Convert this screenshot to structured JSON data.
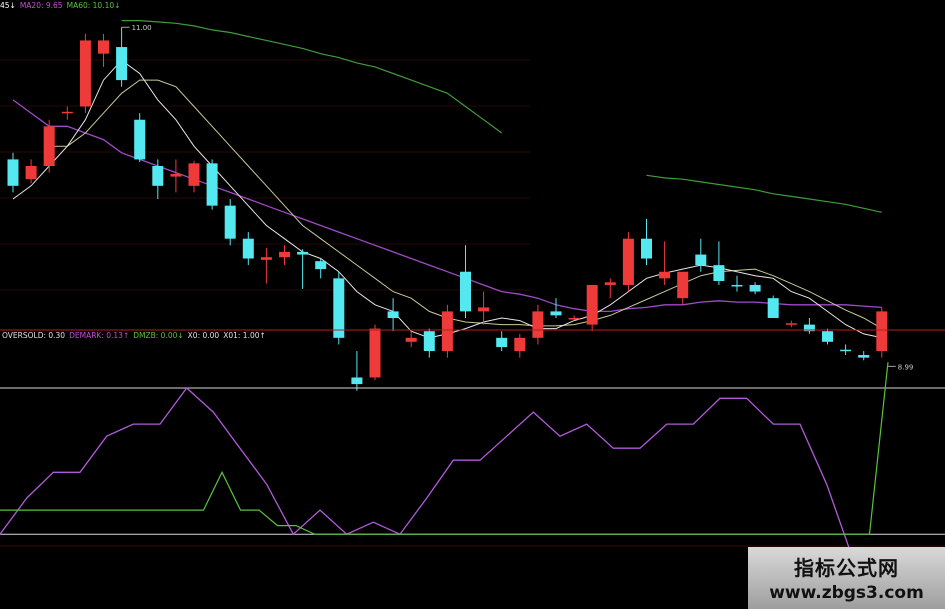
{
  "legend_top": [
    {
      "text": "45↓",
      "color": "#ffffff"
    },
    {
      "text": "MA20: 9.65",
      "color": "#c84fd8"
    },
    {
      "text": "MA60: 10.10↓",
      "color": "#59c33c"
    }
  ],
  "legend_bottom": [
    {
      "text": "OVERSOLD: 0.30",
      "color": "#e0e0e0"
    },
    {
      "text": "DEMARK: 0.13↑",
      "color": "#c84fd8"
    },
    {
      "text": "DMZB: 0.00↓",
      "color": "#59c33c"
    },
    {
      "text": "X0: 0.00",
      "color": "#e0e0e0"
    },
    {
      "text": "X01: 1.00↑",
      "color": "#e0e0e0"
    }
  ],
  "annotations": {
    "high_label": "11.00",
    "low_label": "8.99"
  },
  "watermark": {
    "line1": "指标公式网",
    "line2": "www.zbgs3.com"
  },
  "colors": {
    "up": "#ef3a3a",
    "down": "#54e8f0",
    "ma20": "#a04ac8",
    "ma60": "#3f9c3a",
    "ma_short1": "#e6e6e6",
    "ma_short2": "#c9c99a",
    "demark": "#b05ad8",
    "dmzb": "#59c33c",
    "guide": "#d8d8d8",
    "divider": "#b02020"
  },
  "chart_data": [
    {
      "type": "candlestick",
      "ylim": [
        8.8,
        11.1
      ],
      "candles": [
        {
          "o": 10.0,
          "h": 10.05,
          "l": 9.75,
          "c": 9.8
        },
        {
          "o": 9.85,
          "h": 10.0,
          "l": 9.82,
          "c": 9.95
        },
        {
          "o": 9.95,
          "h": 10.3,
          "l": 9.9,
          "c": 10.25
        },
        {
          "o": 10.35,
          "h": 10.4,
          "l": 10.3,
          "c": 10.36
        },
        {
          "o": 10.4,
          "h": 10.95,
          "l": 10.35,
          "c": 10.9
        },
        {
          "o": 10.8,
          "h": 10.95,
          "l": 10.7,
          "c": 10.9
        },
        {
          "o": 10.85,
          "h": 11.0,
          "l": 10.55,
          "c": 10.6
        },
        {
          "o": 10.3,
          "h": 10.35,
          "l": 9.98,
          "c": 10.0
        },
        {
          "o": 9.95,
          "h": 10.0,
          "l": 9.7,
          "c": 9.8
        },
        {
          "o": 9.87,
          "h": 10.0,
          "l": 9.75,
          "c": 9.89
        },
        {
          "o": 9.8,
          "h": 9.99,
          "l": 9.75,
          "c": 9.97
        },
        {
          "o": 9.97,
          "h": 10.0,
          "l": 9.62,
          "c": 9.65
        },
        {
          "o": 9.65,
          "h": 9.7,
          "l": 9.35,
          "c": 9.4
        },
        {
          "o": 9.4,
          "h": 9.45,
          "l": 9.2,
          "c": 9.25
        },
        {
          "o": 9.24,
          "h": 9.33,
          "l": 9.06,
          "c": 9.26
        },
        {
          "o": 9.26,
          "h": 9.35,
          "l": 9.2,
          "c": 9.3
        },
        {
          "o": 9.3,
          "h": 9.32,
          "l": 9.02,
          "c": 9.28
        },
        {
          "o": 9.23,
          "h": 9.25,
          "l": 9.1,
          "c": 9.17
        },
        {
          "o": 9.1,
          "h": 9.15,
          "l": 8.6,
          "c": 8.65
        },
        {
          "o": 8.35,
          "h": 8.55,
          "l": 8.25,
          "c": 8.3
        },
        {
          "o": 8.35,
          "h": 8.75,
          "l": 8.33,
          "c": 8.72
        },
        {
          "o": 8.85,
          "h": 8.95,
          "l": 8.7,
          "c": 8.8
        },
        {
          "o": 8.62,
          "h": 8.7,
          "l": 8.58,
          "c": 8.65
        },
        {
          "o": 8.7,
          "h": 8.72,
          "l": 8.5,
          "c": 8.55
        },
        {
          "o": 8.55,
          "h": 8.9,
          "l": 8.5,
          "c": 8.85
        },
        {
          "o": 9.15,
          "h": 9.35,
          "l": 8.8,
          "c": 8.85
        },
        {
          "o": 8.85,
          "h": 9.0,
          "l": 8.75,
          "c": 8.88
        },
        {
          "o": 8.65,
          "h": 8.7,
          "l": 8.55,
          "c": 8.58
        },
        {
          "o": 8.55,
          "h": 8.68,
          "l": 8.5,
          "c": 8.65
        },
        {
          "o": 8.65,
          "h": 8.9,
          "l": 8.6,
          "c": 8.85
        },
        {
          "o": 8.85,
          "h": 8.95,
          "l": 8.8,
          "c": 8.82
        },
        {
          "o": 8.8,
          "h": 8.82,
          "l": 8.78,
          "c": 8.8
        },
        {
          "o": 8.75,
          "h": 9.05,
          "l": 8.7,
          "c": 9.05
        },
        {
          "o": 9.05,
          "h": 9.1,
          "l": 8.95,
          "c": 9.07
        },
        {
          "o": 9.05,
          "h": 9.45,
          "l": 9.0,
          "c": 9.4
        },
        {
          "o": 9.4,
          "h": 9.55,
          "l": 9.2,
          "c": 9.25
        },
        {
          "o": 9.1,
          "h": 9.38,
          "l": 9.05,
          "c": 9.15
        },
        {
          "o": 8.95,
          "h": 9.1,
          "l": 8.9,
          "c": 9.15
        },
        {
          "o": 9.28,
          "h": 9.4,
          "l": 9.15,
          "c": 9.2
        },
        {
          "o": 9.2,
          "h": 9.38,
          "l": 9.05,
          "c": 9.08
        },
        {
          "o": 9.05,
          "h": 9.12,
          "l": 9.0,
          "c": 9.04
        },
        {
          "o": 9.05,
          "h": 9.07,
          "l": 8.98,
          "c": 9.0
        },
        {
          "o": 8.95,
          "h": 8.97,
          "l": 8.8,
          "c": 8.8
        },
        {
          "o": 8.75,
          "h": 8.78,
          "l": 8.73,
          "c": 8.76
        },
        {
          "o": 8.75,
          "h": 8.8,
          "l": 8.68,
          "c": 8.7
        },
        {
          "o": 8.7,
          "h": 8.72,
          "l": 8.6,
          "c": 8.62
        },
        {
          "o": 8.56,
          "h": 8.6,
          "l": 8.52,
          "c": 8.55
        },
        {
          "o": 8.52,
          "h": 8.55,
          "l": 8.48,
          "c": 8.5
        },
        {
          "o": 8.55,
          "h": 8.88,
          "l": 8.5,
          "c": 8.85
        }
      ],
      "ma20": [
        10.45,
        10.35,
        10.25,
        10.25,
        10.2,
        10.15,
        10.05,
        10.0,
        9.95,
        9.9,
        9.85,
        9.8,
        9.75,
        9.7,
        9.65,
        9.6,
        9.55,
        9.5,
        9.45,
        9.4,
        9.35,
        9.3,
        9.25,
        9.2,
        9.15,
        9.1,
        9.05,
        9.0,
        8.98,
        8.95,
        8.9,
        8.87,
        8.85,
        8.85,
        8.87,
        8.88,
        8.9,
        8.9,
        8.92,
        8.93,
        8.92,
        8.92,
        8.91,
        8.9,
        8.9,
        8.9,
        8.9,
        8.89,
        8.88
      ],
      "ma60": [
        null,
        null,
        null,
        null,
        null,
        null,
        11.05,
        11.05,
        11.04,
        11.03,
        11.01,
        10.98,
        10.96,
        10.93,
        10.9,
        10.87,
        10.84,
        10.8,
        10.77,
        10.73,
        10.7,
        10.65,
        10.6,
        10.55,
        10.5,
        10.4,
        10.3,
        10.2,
        null,
        null,
        null,
        null,
        null,
        null,
        null,
        9.88,
        9.86,
        9.85,
        9.83,
        9.81,
        9.79,
        9.77,
        9.74,
        9.72,
        9.7,
        9.68,
        9.66,
        9.63,
        9.6
      ],
      "ma5": [
        9.7,
        9.8,
        9.95,
        10.1,
        10.3,
        10.6,
        10.75,
        10.65,
        10.45,
        10.3,
        10.1,
        9.95,
        9.8,
        9.65,
        9.5,
        9.4,
        9.3,
        9.25,
        9.15,
        9.0,
        8.9,
        8.85,
        8.7,
        8.65,
        8.68,
        8.72,
        8.77,
        8.8,
        8.78,
        8.72,
        8.72,
        8.78,
        8.82,
        8.9,
        9.0,
        9.1,
        9.14,
        9.17,
        9.2,
        9.18,
        9.15,
        9.12,
        9.1,
        9.0,
        8.95,
        8.85,
        8.75,
        8.68,
        8.65
      ],
      "ma10": [
        null,
        null,
        10.1,
        10.1,
        10.2,
        10.35,
        10.5,
        10.6,
        10.6,
        10.55,
        10.4,
        10.25,
        10.1,
        9.95,
        9.8,
        9.65,
        9.5,
        9.4,
        9.3,
        9.2,
        9.1,
        9.0,
        8.95,
        8.85,
        8.8,
        8.77,
        8.76,
        8.75,
        8.75,
        8.74,
        8.74,
        8.75,
        8.78,
        8.82,
        8.88,
        8.94,
        9.0,
        9.06,
        9.12,
        9.15,
        9.16,
        9.17,
        9.12,
        9.06,
        9.0,
        8.93,
        8.86,
        8.8,
        8.72
      ]
    },
    {
      "type": "line",
      "ylim": [
        -0.15,
        1.1
      ],
      "guides": {
        "oversold": 0.3,
        "x0": 0.0,
        "x01": 1.0
      },
      "series": [
        {
          "name": "DEMARK",
          "values": [
            0.0,
            0.21,
            0.36,
            0.36,
            0.57,
            0.64,
            0.64,
            0.85,
            0.71,
            0.5,
            0.29,
            0.0,
            0.14,
            0.0,
            0.07,
            0.0,
            0.21,
            0.43,
            0.43,
            0.57,
            0.71,
            0.57,
            0.64,
            0.5,
            0.5,
            0.64,
            0.64,
            0.79,
            0.79,
            0.64,
            0.64,
            0.29,
            -0.15,
            -0.15
          ]
        },
        {
          "name": "DMZB",
          "values": [
            0.14,
            0.14,
            0.14,
            0.14,
            0.14,
            0.14,
            0.14,
            0.14,
            0.14,
            0.14,
            0.14,
            0.14,
            0.36,
            0.14,
            0.14,
            0.05,
            0.05,
            0.0,
            0.0,
            0.0,
            0.0,
            0.0,
            0.0,
            0.0,
            0.0,
            0.0,
            0.0,
            0.0,
            0.0,
            0.0,
            0.0,
            0.0,
            0.0,
            0.0,
            0.0,
            0.0,
            0.0,
            0.0,
            0.0,
            0.0,
            0.0,
            0.0,
            0.0,
            0.0,
            0.0,
            0.0,
            0.0,
            0.0,
            1.0
          ]
        }
      ]
    }
  ]
}
